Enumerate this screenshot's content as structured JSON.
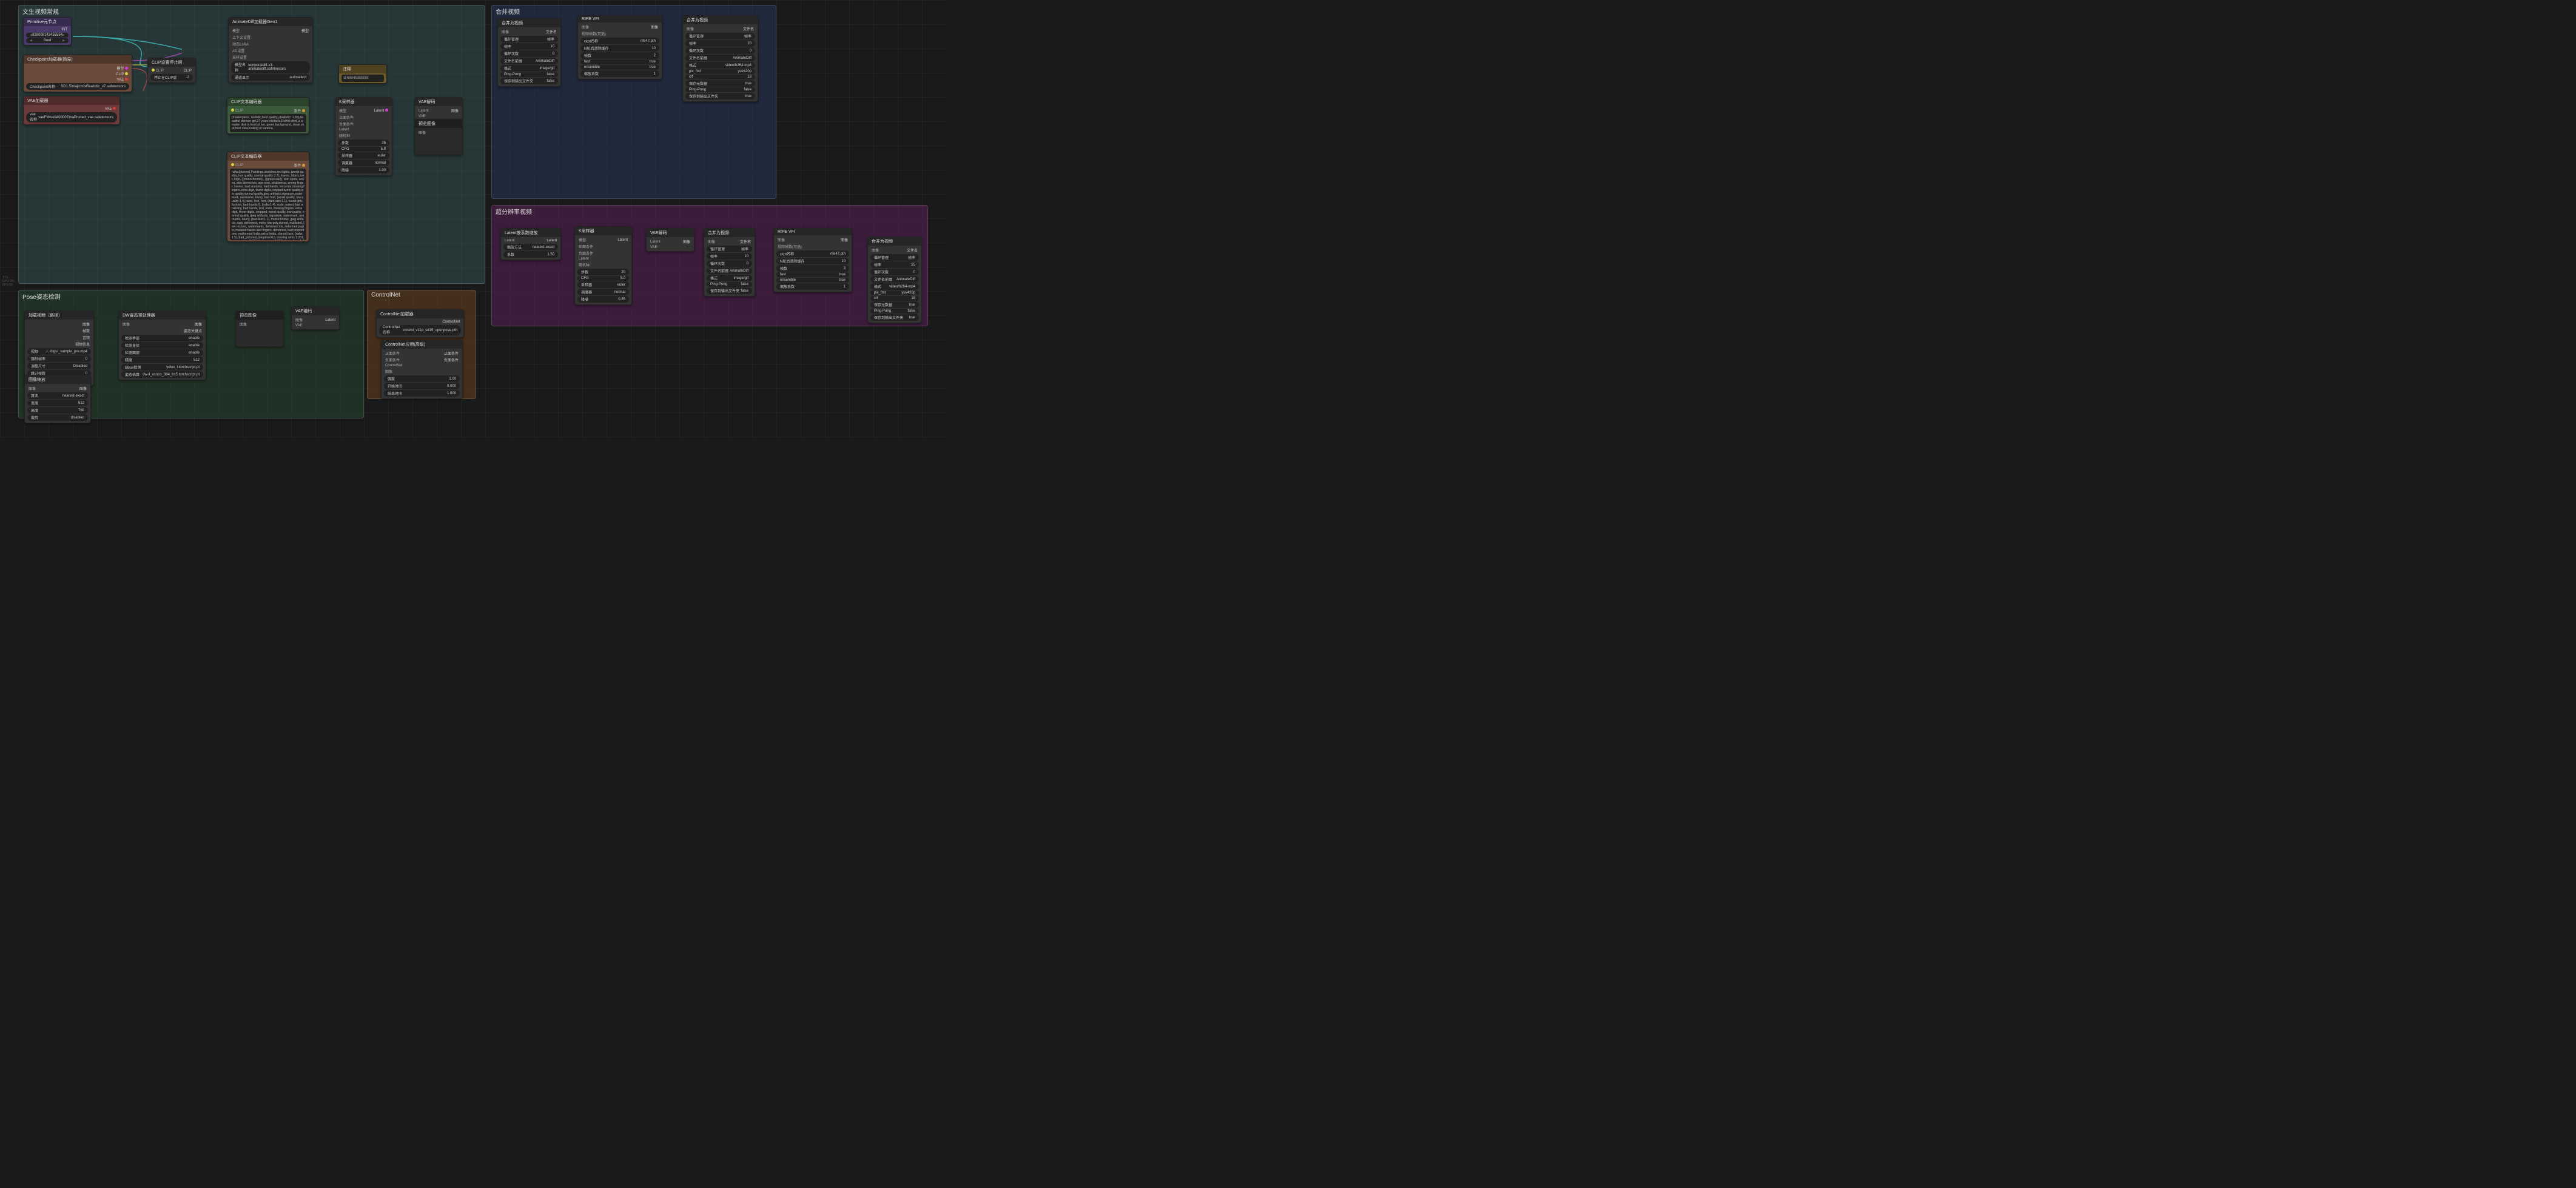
{
  "groups": {
    "txt2vid": {
      "title": "文生视频常规"
    },
    "merge": {
      "title": "合并视频"
    },
    "pose": {
      "title": "Pose姿态检测"
    },
    "controlnet": {
      "title": "ControlNet"
    },
    "upscale": {
      "title": "超分辨率视频"
    }
  },
  "nodes": {
    "primitive": {
      "title": "Primitive元节点",
      "outputs": [
        "INT"
      ],
      "widgets": [
        {
          "label": "value",
          "value": "828008143455554"
        },
        {
          "label": "control_after_generate",
          "value": "fixed"
        }
      ]
    },
    "checkpoint": {
      "title": "Checkpoint加载器(简易)",
      "outputs": [
        "模型",
        "CLIP",
        "VAE"
      ],
      "widget": {
        "label": "Checkpoint名称",
        "value": "SD1.5/majicmixRealistic_v7.safetensors"
      }
    },
    "vae_loader": {
      "title": "VAE加载器",
      "outputs": [
        "VAE"
      ],
      "widget": {
        "label": "vae名称",
        "value": "vaeFtMse840000EmaPruned_vae.safetensors"
      }
    },
    "clip_stop": {
      "title": "CLIP设置停止层",
      "inputs": [
        "CLIP"
      ],
      "outputs": [
        "CLIP"
      ],
      "widget": {
        "label": "停止在CLIP层",
        "value": "-2"
      }
    },
    "animatediff": {
      "title": "AnimateDiff加载器Gen1",
      "inputs": [
        "模型",
        "上下文设置",
        "动态LoRA",
        "AD设置",
        "采样设置"
      ],
      "outputs": [
        "模型"
      ],
      "widgets": [
        {
          "label": "模型名称",
          "value": "temporaldiff-v1-animatediff.safetensors"
        },
        {
          "label": "通道显示",
          "value": "autoselect"
        }
      ]
    },
    "note": {
      "title": "注释",
      "text": "114000450005000"
    },
    "clip_pos": {
      "title": "CLIP文本编码器",
      "inputs": [
        "CLIP"
      ],
      "outputs": [
        "条件"
      ],
      "text": "(masterpiece, realistic,best quality),(realistic: 1.35),beautiful chinese girl,27 years old,facis,DefArt shirt),a wooden disk in front of her, green background, clean shot,front view,looking at camera."
    },
    "clip_neg": {
      "title": "CLIP文本编码器",
      "inputs": [
        "CLIP"
      ],
      "outputs": [
        "条件"
      ],
      "text": "nsfw,(blurred),Paintings,sketches,red lights, (worst quality, low quality, normal quality:1.7), lowres, blurry, text, logo, ((monochrome)), ((grayscale)), skin spots, acnes, skin blemishes, age spot, strabismus, wrong finger, lowres, bad anatomy, bad hands, text,error,missing fingers,extra digit, fewer digits,cropped,worst quality,low quality,normal quality,jpeg artifacts,signature,watermark, username, blurry, bad feet, (worst quality, low quality:1.4),hand, feet, foot, (dark skin:1.1), fused girls, fushion, bad-hands-5, (nsfw:1.4), nude, naked, bad anatomy, bad hands, text, error, missing fingers, extra digit, fewer digits, cropped, worst quality, low quality, normal quality, jpeg artifacts, signature, watermark, username, blurry, (bad-feet:1.1), monochrome, jpeg artifacts, ugly, deformed, noisy, low poly,cloned, mutilated, low res,text, watermarks, deformed iris, deformed pupils, mutated hands and fingers, deformed, bad proportions, malformed limbs,extra limbs, cloned face, (nsfw:1.5),(bad_pictures),(negativeXL), missing arms:1.331, missing legs:1.331, (extra arms:1.331), (extra legs:1.331),3d, cg, text, bad anatomy, bad hands, text, error, missing fingers, extra digit, fewer digits, (worst quality, low quality, normal quality, jpeg artifacts, signature, watermark, username), blurry, low quality, low quality, normal quality, jpeg artifacts, signature, watermark, username, bad hands, text, error, missing fingers, extra digit, fewer digits, low quality, lowres, bad anatomy, bad hands, text, error, missing fingers, extra digit, fewer digits, cropped, worst quality, low quality, normal quality, jpeg artifacts, signature, watermark, username, blurry,huge breasts,Large Breast,cloth,children,extra hands,extra legs(disfigured),(bad art), (deformed),(ugly face, deformed face,partial face),(bad proportions),(ugly eyes),mutilated, mutilation,tripod,bad composition,poorly drawn,cartoon,lowres,multiple views,multiple face,multiple views,Multiple Face,Button"
    },
    "ksampler1": {
      "title": "K采样器",
      "inputs": [
        "模型",
        "正面条件",
        "负面条件",
        "Latent",
        "随机种"
      ],
      "outputs": [
        "Latent"
      ],
      "widgets": [
        {
          "label": "步数",
          "value": "26"
        },
        {
          "label": "CFG",
          "value": "5.8"
        },
        {
          "label": "采样器",
          "value": "euler"
        },
        {
          "label": "调度器",
          "value": "normal"
        },
        {
          "label": "降噪",
          "value": "1.00"
        }
      ]
    },
    "vae_decode1": {
      "title": "VAE解码",
      "inputs": [
        "Latent",
        "VAE"
      ],
      "outputs": [
        "图像"
      ]
    },
    "preview1": {
      "title": "预览图像",
      "inputs": [
        "图像"
      ]
    },
    "combine1": {
      "title": "合并为视频",
      "inputs": [
        "图像"
      ],
      "outputs": [
        "文件名"
      ],
      "widgets": [
        {
          "label": "循环管理",
          "value": "帧率"
        },
        {
          "label": "帧率",
          "value": "10"
        },
        {
          "label": "循环次数",
          "value": "0"
        },
        {
          "label": "文件名前缀",
          "value": "AnimateDiff"
        },
        {
          "label": "格式",
          "value": "image/gif"
        },
        {
          "label": "Ping-Pong",
          "value": "false"
        },
        {
          "label": "保存到输出文件夹",
          "value": "false"
        }
      ]
    },
    "rife1": {
      "title": "RIFE VFI",
      "inputs": [
        "图像",
        "视频帧数(可选)"
      ],
      "outputs": [
        "图像"
      ],
      "widgets": [
        {
          "label": "ckpt名称",
          "value": "rife47.pth"
        },
        {
          "label": "N轮后清除缓存",
          "value": "10"
        },
        {
          "label": "帧数",
          "value": "2"
        },
        {
          "label": "fast",
          "value": "true"
        },
        {
          "label": "ensemble",
          "value": "true"
        },
        {
          "label": "缩放系数",
          "value": "1"
        }
      ]
    },
    "combine2": {
      "title": "合并为视频",
      "inputs": [
        "图像"
      ],
      "outputs": [
        "文件名"
      ],
      "widgets": [
        {
          "label": "循环管理",
          "value": "帧率"
        },
        {
          "label": "帧率",
          "value": "20"
        },
        {
          "label": "循环次数",
          "value": "0"
        },
        {
          "label": "文件名前缀",
          "value": "AnimateDiff"
        },
        {
          "label": "格式",
          "value": "video/h264-mp4"
        },
        {
          "label": "pix_fmt",
          "value": "yuv420p"
        },
        {
          "label": "crf",
          "value": "18"
        },
        {
          "label": "保存元数据",
          "value": "true"
        },
        {
          "label": "Ping-Pong",
          "value": "false"
        },
        {
          "label": "保存到输出文件夹",
          "value": "true"
        }
      ]
    },
    "load_video": {
      "title": "加载视频（路径）",
      "outputs": [
        "图像",
        "帧数",
        "音频",
        "视频信息"
      ],
      "widgets": [
        {
          "label": "视频",
          "value": "./../digui_sample_pre.mp4"
        },
        {
          "label": "强制帧率",
          "value": "0"
        },
        {
          "label": "调整尺寸",
          "value": "Disabled"
        },
        {
          "label": "跳过帧数",
          "value": "0"
        },
        {
          "label": "加载帧数上限",
          "value": "24"
        }
      ]
    },
    "img_scale": {
      "title": "图像缩放",
      "inputs": [
        "图像"
      ],
      "outputs": [
        "图像"
      ],
      "widgets": [
        {
          "label": "算法",
          "value": "nearest-exact"
        },
        {
          "label": "宽度",
          "value": "512"
        },
        {
          "label": "高度",
          "value": "768"
        },
        {
          "label": "裁剪",
          "value": "disabled"
        }
      ]
    },
    "dw_pose": {
      "title": "DW姿态预处理器",
      "inputs": [
        "图像"
      ],
      "outputs": [
        "图像",
        "姿态关键点"
      ],
      "widgets": [
        {
          "label": "检测手部",
          "value": "enable"
        },
        {
          "label": "检测身体",
          "value": "enable"
        },
        {
          "label": "检测面部",
          "value": "enable"
        },
        {
          "label": "精度",
          "value": "512"
        },
        {
          "label": "BBox检测",
          "value": "yolox_l.torchscript.pt"
        },
        {
          "label": "姿态估算",
          "value": "dw-ll_ucoco_384_bs5.torchscript.pt"
        }
      ]
    },
    "preview2": {
      "title": "预览图像",
      "inputs": [
        "图像"
      ]
    },
    "vae_encode": {
      "title": "VAE编码",
      "inputs": [
        "图像",
        "VAE"
      ],
      "outputs": [
        "Latent"
      ]
    },
    "cn_loader": {
      "title": "ControlNet加载器",
      "outputs": [
        "ControlNet"
      ],
      "widget": {
        "label": "ControlNet名称",
        "value": "control_v11p_sd15_openpose.pth"
      }
    },
    "cn_apply": {
      "title": "ControlNet应用(高级)",
      "inputs": [
        "正面条件",
        "负面条件",
        "ControlNet",
        "图像"
      ],
      "outputs": [
        "正面条件",
        "负面条件"
      ],
      "widgets": [
        {
          "label": "强度",
          "value": "1.00"
        },
        {
          "label": "开始时间",
          "value": "0.000"
        },
        {
          "label": "结束时间",
          "value": "1.000"
        }
      ]
    },
    "latent_upscale": {
      "title": "Latent按系数缩放",
      "inputs": [
        "Latent"
      ],
      "outputs": [
        "Latent"
      ],
      "widgets": [
        {
          "label": "缩放方法",
          "value": "nearest-exact"
        },
        {
          "label": "系数",
          "value": "1.50"
        }
      ]
    },
    "ksampler2": {
      "title": "K采样器",
      "inputs": [
        "模型",
        "正面条件",
        "负面条件",
        "Latent",
        "随机种"
      ],
      "outputs": [
        "Latent"
      ],
      "widgets": [
        {
          "label": "步数",
          "value": "20"
        },
        {
          "label": "CFG",
          "value": "5.0"
        },
        {
          "label": "采样器",
          "value": "euler"
        },
        {
          "label": "调度器",
          "value": "normal"
        },
        {
          "label": "降噪",
          "value": "0.55"
        }
      ]
    },
    "vae_decode2": {
      "title": "VAE解码",
      "inputs": [
        "Latent",
        "VAE"
      ],
      "outputs": [
        "图像"
      ]
    },
    "combine3": {
      "title": "合并为视频",
      "inputs": [
        "图像"
      ],
      "outputs": [
        "文件名"
      ],
      "widgets": [
        {
          "label": "循环管理",
          "value": "帧率"
        },
        {
          "label": "帧率",
          "value": "10"
        },
        {
          "label": "循环次数",
          "value": "0"
        },
        {
          "label": "文件名前缀",
          "value": "AnimateDiff"
        },
        {
          "label": "格式",
          "value": "image/gif"
        },
        {
          "label": "Ping-Pong",
          "value": "false"
        },
        {
          "label": "保存到输出文件夹",
          "value": "false"
        }
      ]
    },
    "rife2": {
      "title": "RIFE VFI",
      "inputs": [
        "图像",
        "视频帧数(可选)"
      ],
      "outputs": [
        "图像"
      ],
      "widgets": [
        {
          "label": "ckpt名称",
          "value": "rife47.pth"
        },
        {
          "label": "N轮后清除缓存",
          "value": "10"
        },
        {
          "label": "帧数",
          "value": "3"
        },
        {
          "label": "fast",
          "value": "true"
        },
        {
          "label": "ensemble",
          "value": "true"
        },
        {
          "label": "缩放系数",
          "value": "1"
        }
      ]
    },
    "combine4": {
      "title": "合并为视频",
      "inputs": [
        "图像"
      ],
      "outputs": [
        "文件名"
      ],
      "widgets": [
        {
          "label": "循环管理",
          "value": "帧率"
        },
        {
          "label": "帧率",
          "value": "25"
        },
        {
          "label": "循环次数",
          "value": "0"
        },
        {
          "label": "文件名前缀",
          "value": "AnimateDiff"
        },
        {
          "label": "格式",
          "value": "video/h264-mp4"
        },
        {
          "label": "pix_fmt",
          "value": "yuv420p"
        },
        {
          "label": "crf",
          "value": "18"
        },
        {
          "label": "保存元数据",
          "value": "true"
        },
        {
          "label": "Ping-Pong",
          "value": "false"
        },
        {
          "label": "保存到输出文件夹",
          "value": "true"
        }
      ]
    }
  },
  "stats": {
    "l1": "T 7s",
    "l2": "GPU 3%",
    "l3": "FPS 60"
  },
  "empty_hint": ""
}
